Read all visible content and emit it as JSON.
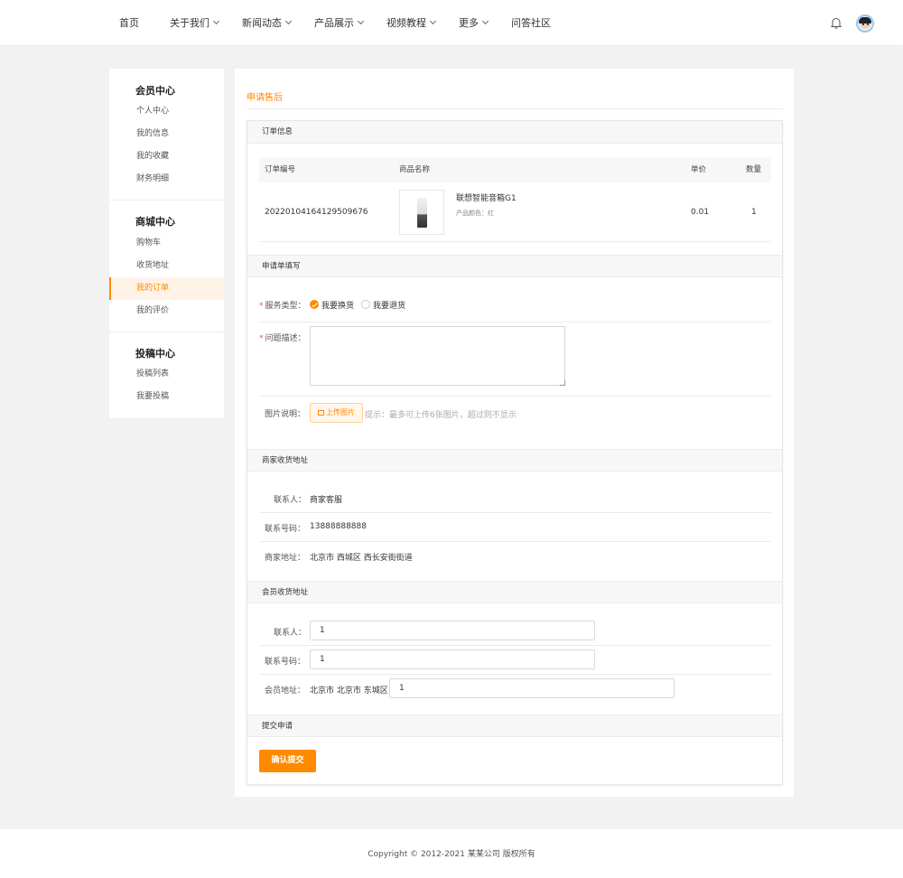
{
  "nav": {
    "items": [
      {
        "label": "首页",
        "has_dropdown": false
      },
      {
        "label": "关于我们",
        "has_dropdown": true
      },
      {
        "label": "新闻动态",
        "has_dropdown": true
      },
      {
        "label": "产品展示",
        "has_dropdown": true
      },
      {
        "label": "视频教程",
        "has_dropdown": true
      },
      {
        "label": "更多",
        "has_dropdown": true
      },
      {
        "label": "问答社区",
        "has_dropdown": false
      }
    ],
    "icons": [
      "bell-icon",
      "avatar"
    ]
  },
  "sidebar": {
    "groups": [
      {
        "title": "会员中心",
        "items": [
          "个人中心",
          "我的信息",
          "我的收藏",
          "财务明细"
        ]
      },
      {
        "title": "商城中心",
        "items": [
          "购物车",
          "收货地址",
          "我的订单",
          "我的评价"
        ]
      },
      {
        "title": "投稿中心",
        "items": [
          "投稿列表",
          "我要投稿"
        ]
      }
    ],
    "active_item": "我的订单"
  },
  "page": {
    "title": "申请售后"
  },
  "order_info": {
    "heading": "订单信息",
    "columns": {
      "order_no": "订单编号",
      "product": "商品名称",
      "price": "单价",
      "qty": "数量"
    },
    "row": {
      "order_no": "20220104164129509676",
      "product_name": "联想智能音箱G1",
      "product_attr": "产品颜色：红",
      "price": "0.01",
      "qty": "1"
    }
  },
  "application": {
    "heading": "申请单填写",
    "service_type_label": "服务类型：",
    "options": [
      "我要换货",
      "我要退货"
    ],
    "selected_option": "我要换货",
    "description_label": "问题描述：",
    "description_value": "",
    "image_label": "图片说明：",
    "upload_label": "上传图片",
    "upload_hint": "提示：最多可上传6张图片，超过则不显示"
  },
  "merchant": {
    "heading": "商家收货地址",
    "contact_label": "联系人：",
    "contact": "商家客服",
    "phone_label": "联系号码：",
    "phone": "13888888888",
    "address_label": "商家地址：",
    "address": "北京市 西城区 西长安街街道"
  },
  "member": {
    "heading": "会员收货地址",
    "contact_label": "联系人：",
    "contact_value": "1",
    "phone_label": "联系号码：",
    "phone_value": "1",
    "address_label": "会员地址：",
    "region": "北京市 北京市 东城区",
    "address_value": "1"
  },
  "submit": {
    "heading": "提交申请",
    "button": "确认提交"
  },
  "footer": {
    "copyright": "Copyright © 2012-2021 某某公司 版权所有"
  },
  "colors": {
    "accent": "#ff8a00",
    "required": "#ff4d2b"
  }
}
